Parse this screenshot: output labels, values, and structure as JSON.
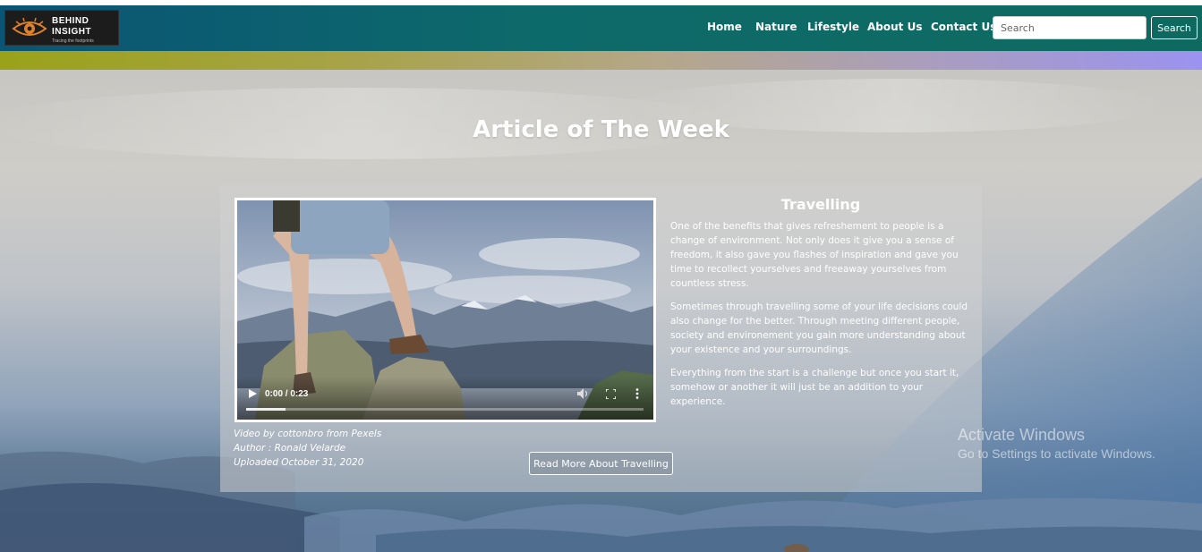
{
  "navbar": {
    "logo": {
      "line1": "BEHIND",
      "line2": "INSIGHT",
      "tagline": "Tracing the footprints",
      "icon": "eye-icon"
    },
    "links": [
      "Home",
      "Nature",
      "Lifestyle",
      "About Us",
      "Contact Us"
    ],
    "search": {
      "placeholder": "Search",
      "value": "",
      "button_label": "Search"
    }
  },
  "hero": {
    "title": "Article of The Week"
  },
  "card": {
    "video": {
      "time": "0:00 / 0:23",
      "progress": 0.1,
      "controls": [
        "play-icon",
        "volume-icon",
        "fullscreen-icon",
        "menu-icon"
      ]
    },
    "credits": [
      "Video by cottonbro from Pexels",
      "Author : Ronald Velarde",
      "Uploaded October 31, 2020"
    ],
    "article": {
      "title": "Travelling",
      "paragraphs": [
        "One of the benefits that gives refreshement to people is a change of environment. Not only does it give you a sense of freedom, it also gave you flashes of inspiration and gave you time to recollect yourselves and freeaway yourselves from countless stress.",
        "Sometimes through travelling some of your life decisions could also change for the better. Through meeting different people, society and environement you gain more understanding about your existence and your surroundings.",
        "Everything from the start is a challenge but once you start it, somehow or another it will just be an addition to your experience."
      ]
    }
  },
  "read_more": {
    "label": "Read More About Travelling"
  },
  "watermark": {
    "title": "Activate Windows",
    "subtitle": "Go to Settings to activate Windows."
  },
  "colors": {
    "navbar_start": "#0a5475",
    "navbar_end": "#0e6a5f",
    "band_start": "#9aa21a",
    "band_end": "#9b93f0"
  }
}
